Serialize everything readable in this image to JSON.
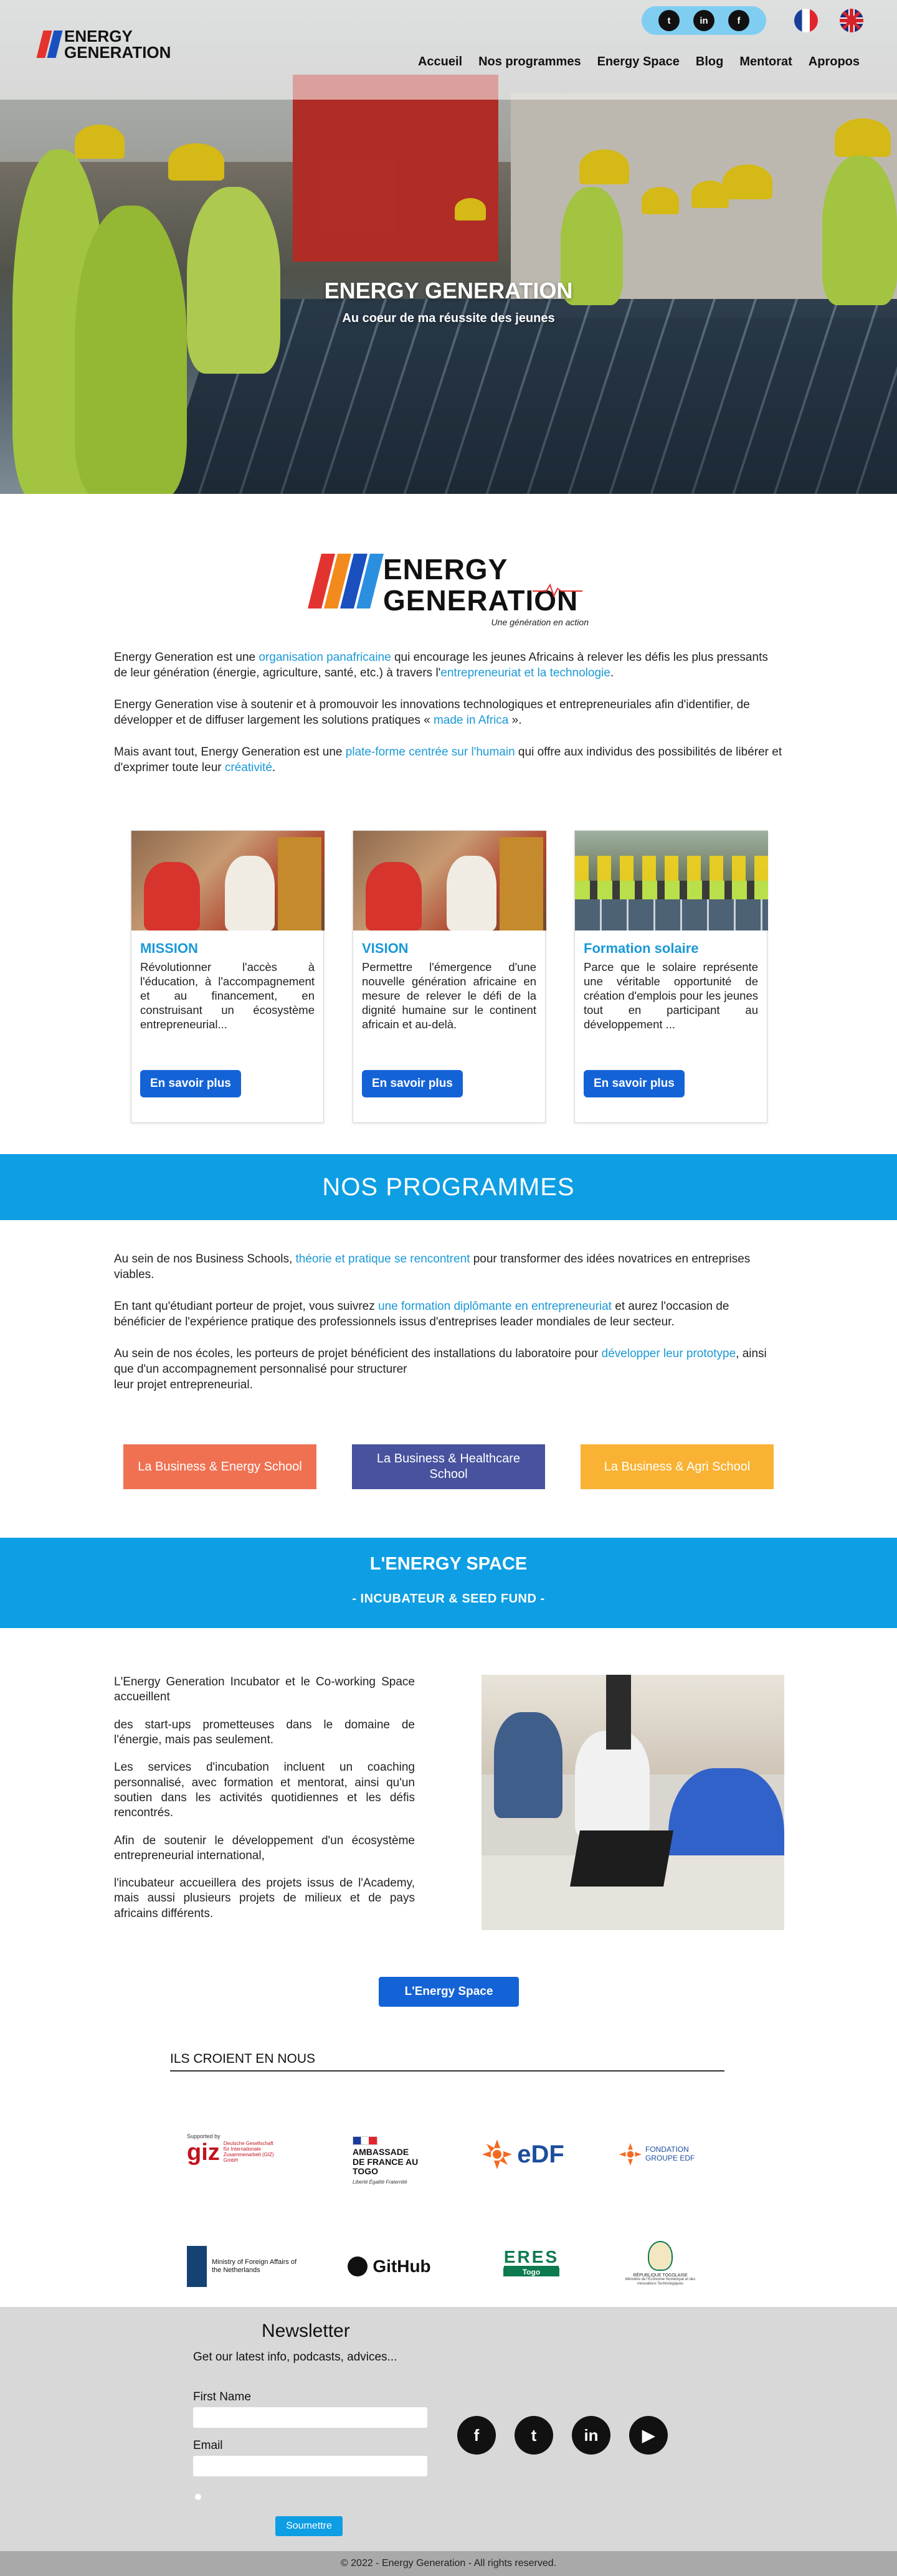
{
  "header": {
    "logo": {
      "line1": "ENERGY",
      "line2": "GENERATION"
    },
    "social": [
      {
        "name": "twitter-icon",
        "glyph": "t"
      },
      {
        "name": "linkedin-icon",
        "glyph": "in"
      },
      {
        "name": "facebook-icon",
        "glyph": "f"
      }
    ],
    "nav": [
      "Accueil",
      "Nos programmes",
      "Energy Space",
      "Blog",
      "Mentorat",
      "Apropos"
    ]
  },
  "hero": {
    "title": "ENERGY GENERATION",
    "subtitle": "Au coeur de ma réussite des jeunes"
  },
  "intro": {
    "logo": {
      "line1": "ENERGY",
      "line2": "GENERATION",
      "tagline": "Une génération en action"
    },
    "p1_a": "Energy Generation est une ",
    "p1_hl1": "organisation panafricaine",
    "p1_b": " qui encourage les jeunes Africains à relever les défis les plus pressants de leur génération (énergie, agriculture, santé, etc.) à travers l'",
    "p1_hl2": "entrepreneuriat et la technologie",
    "p1_c": ".",
    "p2": "Energy Generation vise à soutenir et à promouvoir les innovations technologiques et entrepreneuriales afin d'identifier, de développer et de diffuser largement les solutions pratiques « ",
    "p2_hl": "made in Africa",
    "p2_end": " ».",
    "p3_a": "Mais avant tout, Energy Generation est une ",
    "p3_hl1": "plate-forme centrée sur l'humain",
    "p3_b": " qui offre aux individus des possibilités de libérer et d'exprimer toute leur ",
    "p3_hl2": "créativité",
    "p3_c": "."
  },
  "cards": [
    {
      "title": "MISSION",
      "text": "Révolutionner l'accès à l'éducation, à l'accompagnement et au financement, en construisant un écosystème entrepreneurial...",
      "button": "En savoir plus"
    },
    {
      "title": "VISION",
      "text": "Permettre l'émergence d'une nouvelle génération africaine en mesure de relever le défi de la dignité humaine sur le continent africain et au-delà.",
      "button": "En savoir plus"
    },
    {
      "title": "Formation solaire",
      "text": "Parce que le solaire représente une véritable opportunité de création d'emplois pour les jeunes tout en participant au développement ...",
      "button": "En savoir plus"
    }
  ],
  "programmes": {
    "heading": "NOS PROGRAMMES",
    "p1_a": "Au sein de nos Business Schools, ",
    "p1_hl": "théorie et pratique se rencontrent",
    "p1_b": " pour transformer des idées novatrices en entreprises viables.",
    "p2_a": "En tant qu'étudiant porteur de projet, vous suivrez ",
    "p2_hl": "une formation diplômante en entrepreneuriat",
    "p2_b": " et aurez l'occasion de bénéficier de l'expérience pratique des professionnels issus d'entreprises leader mondiales de leur secteur.",
    "p3_a": "Au sein de nos écoles, les porteurs de projet bénéficient des installations du laboratoire pour ",
    "p3_hl": "développer leur prototype",
    "p3_b": ", ainsi que d'un accompagnement personnalisé pour structurer",
    "p3_c": "leur projet entrepreneurial.",
    "schools": [
      {
        "label": "La Business & Energy School",
        "color": "#ef7152"
      },
      {
        "label": "La Business & Healthcare School",
        "color": "#48529e"
      },
      {
        "label": "La Business & Agri School",
        "color": "#f9b233"
      }
    ]
  },
  "energy_space": {
    "heading": "L'ENERGY SPACE",
    "subheading": "- INCUBATEUR & SEED FUND -",
    "p1": "L'Energy Generation Incubator et le Co-working Space accueillent",
    "p2": "des start-ups prometteuses dans le domaine de l'énergie, mais pas seulement.",
    "p3": "Les services d'incubation incluent un coaching personnalisé, avec formation et mentorat, ainsi qu'un soutien dans les activités quotidiennes et les défis rencontrés.",
    "p4": "Afin de soutenir le développement d'un écosystème entrepreneurial international,",
    "p5": "l'incubateur accueillera des projets issus de l'Academy, mais aussi plusieurs projets de milieux et de pays africains différents.",
    "button": "L'Energy Space",
    "supporters_heading": "ILS CROIENT EN NOUS"
  },
  "partners": [
    {
      "name": "giz",
      "supported": "Supported by",
      "text": "giz",
      "small": "Deutsche Gesellschaft für Internationale Zusammenarbeit (GIZ) GmbH"
    },
    {
      "name": "ambassade",
      "text": "AMBASSADE DE FRANCE AU TOGO",
      "small": "Liberté Égalité Fraternité"
    },
    {
      "name": "edf",
      "text": "eDF"
    },
    {
      "name": "fondation-edf",
      "text": "FONDATION GROUPE EDF"
    },
    {
      "name": "netherlands",
      "text": "Ministry of Foreign Affairs of the Netherlands"
    },
    {
      "name": "github",
      "text": "GitHub"
    },
    {
      "name": "eres",
      "text": "ERES",
      "small": "Togo"
    },
    {
      "name": "republique-togolaise",
      "text": "RÉPUBLIQUE TOGOLAISE",
      "small": "Ministère de l'Économie Numérique et des Innovations Technologiques"
    }
  ],
  "newsletter": {
    "title": "Newsletter",
    "subtitle": "Get our latest info, podcasts, advices...",
    "first_name_label": "First Name",
    "email_label": "Email",
    "submit": "Soumettre",
    "social": [
      {
        "name": "facebook-icon",
        "glyph": "f"
      },
      {
        "name": "twitter-icon",
        "glyph": "t"
      },
      {
        "name": "linkedin-icon",
        "glyph": "in"
      },
      {
        "name": "youtube-icon",
        "glyph": "▶"
      }
    ]
  },
  "footer": {
    "copyright": "© 2022 - Energy Generation - All rights reserved."
  },
  "colors": {
    "accent": "#0d9ee3",
    "button": "#1463d6",
    "link": "#1a99d7"
  }
}
